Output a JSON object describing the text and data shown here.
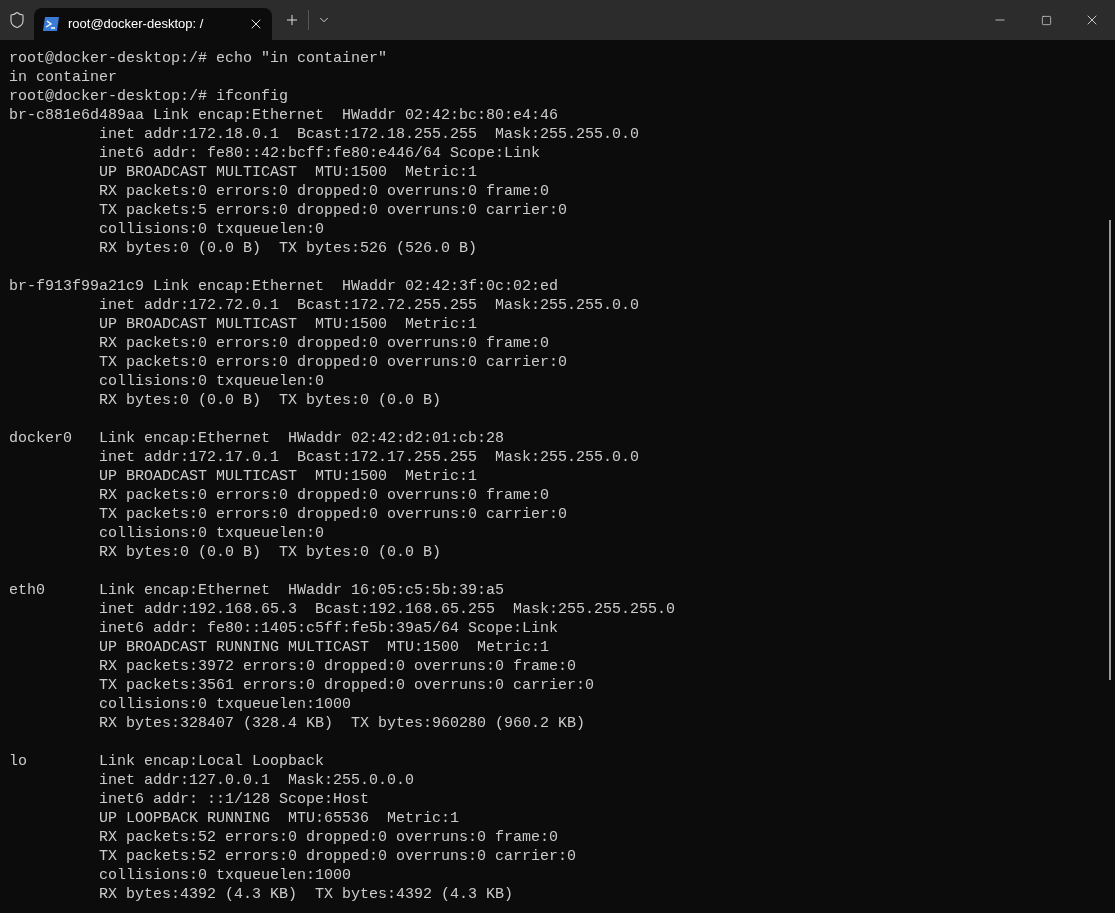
{
  "tabs": [
    {
      "title": "root@docker-desktop: /",
      "selected": true
    }
  ],
  "terminal": {
    "blocks": [
      {
        "lines": [
          "root@docker-desktop:/# echo \"in container\"",
          "in container",
          "root@docker-desktop:/# ifconfig",
          "br-c881e6d489aa Link encap:Ethernet  HWaddr 02:42:bc:80:e4:46",
          "          inet addr:172.18.0.1  Bcast:172.18.255.255  Mask:255.255.0.0",
          "          inet6 addr: fe80::42:bcff:fe80:e446/64 Scope:Link",
          "          UP BROADCAST MULTICAST  MTU:1500  Metric:1",
          "          RX packets:0 errors:0 dropped:0 overruns:0 frame:0",
          "          TX packets:5 errors:0 dropped:0 overruns:0 carrier:0",
          "          collisions:0 txqueuelen:0",
          "          RX bytes:0 (0.0 B)  TX bytes:526 (526.0 B)"
        ]
      },
      {
        "lines": [
          "br-f913f99a21c9 Link encap:Ethernet  HWaddr 02:42:3f:0c:02:ed",
          "          inet addr:172.72.0.1  Bcast:172.72.255.255  Mask:255.255.0.0",
          "          UP BROADCAST MULTICAST  MTU:1500  Metric:1",
          "          RX packets:0 errors:0 dropped:0 overruns:0 frame:0",
          "          TX packets:0 errors:0 dropped:0 overruns:0 carrier:0",
          "          collisions:0 txqueuelen:0",
          "          RX bytes:0 (0.0 B)  TX bytes:0 (0.0 B)"
        ]
      },
      {
        "lines": [
          "docker0   Link encap:Ethernet  HWaddr 02:42:d2:01:cb:28",
          "          inet addr:172.17.0.1  Bcast:172.17.255.255  Mask:255.255.0.0",
          "          UP BROADCAST MULTICAST  MTU:1500  Metric:1",
          "          RX packets:0 errors:0 dropped:0 overruns:0 frame:0",
          "          TX packets:0 errors:0 dropped:0 overruns:0 carrier:0",
          "          collisions:0 txqueuelen:0",
          "          RX bytes:0 (0.0 B)  TX bytes:0 (0.0 B)"
        ]
      },
      {
        "lines": [
          "eth0      Link encap:Ethernet  HWaddr 16:05:c5:5b:39:a5",
          "          inet addr:192.168.65.3  Bcast:192.168.65.255  Mask:255.255.255.0",
          "          inet6 addr: fe80::1405:c5ff:fe5b:39a5/64 Scope:Link",
          "          UP BROADCAST RUNNING MULTICAST  MTU:1500  Metric:1",
          "          RX packets:3972 errors:0 dropped:0 overruns:0 frame:0",
          "          TX packets:3561 errors:0 dropped:0 overruns:0 carrier:0",
          "          collisions:0 txqueuelen:1000",
          "          RX bytes:328407 (328.4 KB)  TX bytes:960280 (960.2 KB)"
        ]
      },
      {
        "lines": [
          "lo        Link encap:Local Loopback",
          "          inet addr:127.0.0.1  Mask:255.0.0.0",
          "          inet6 addr: ::1/128 Scope:Host",
          "          UP LOOPBACK RUNNING  MTU:65536  Metric:1",
          "          RX packets:52 errors:0 dropped:0 overruns:0 frame:0",
          "          TX packets:52 errors:0 dropped:0 overruns:0 carrier:0",
          "          collisions:0 txqueuelen:1000",
          "          RX bytes:4392 (4.3 KB)  TX bytes:4392 (4.3 KB)"
        ]
      }
    ]
  }
}
